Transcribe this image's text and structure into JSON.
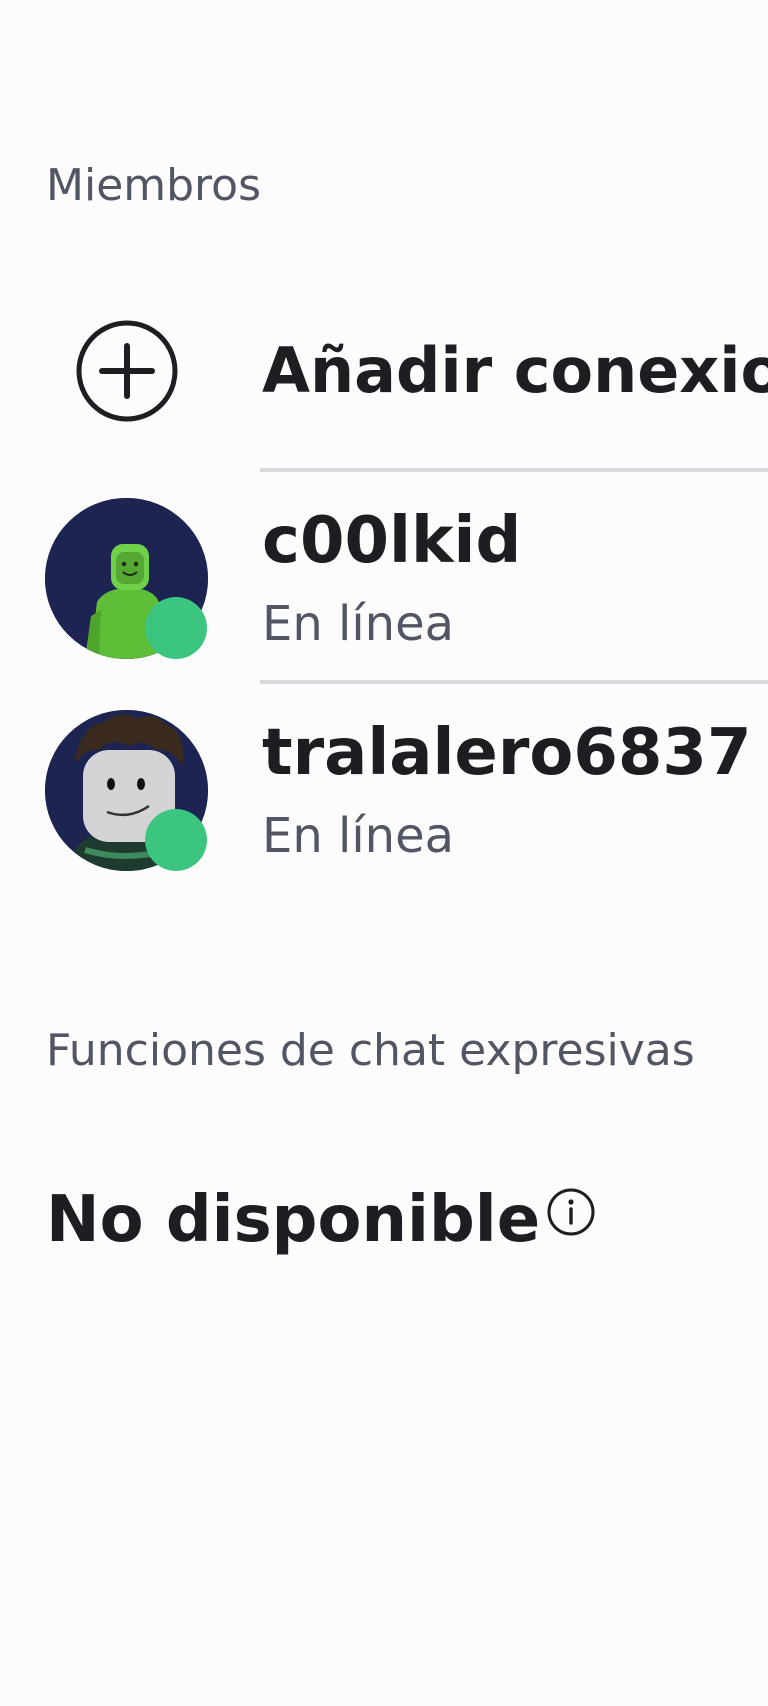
{
  "members_section": {
    "label": "Miembros",
    "add_connection": {
      "label": "Añadir conexiones",
      "icon": "plus-circle-icon"
    },
    "members": [
      {
        "name": "c00lkid",
        "status": "En línea",
        "status_color": "#3cc57f"
      },
      {
        "name": "tralalero6837",
        "status": "En línea",
        "status_color": "#3cc57f"
      }
    ]
  },
  "expressive_chat": {
    "label": "Funciones de chat expresivas",
    "value": "No disponible",
    "info_icon": "info-icon"
  },
  "colors": {
    "background": "#fcfcfd",
    "text_primary": "#1d1e22",
    "text_secondary": "#525663",
    "online": "#3cc57f",
    "divider": "#d8d9df",
    "avatar_bg": "#1d2452"
  }
}
